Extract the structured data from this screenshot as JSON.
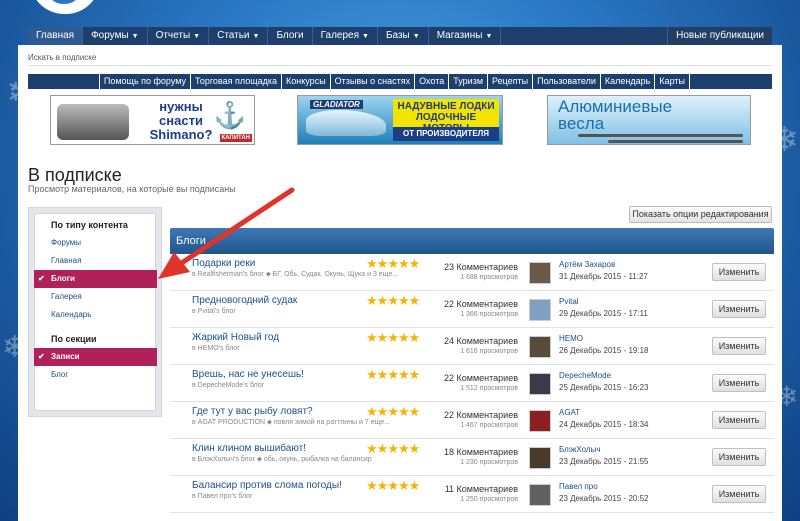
{
  "top_nav": {
    "items": [
      {
        "label": "Главная",
        "caret": ""
      },
      {
        "label": "Форумы",
        "caret": "▼"
      },
      {
        "label": "Отчеты",
        "caret": "▼"
      },
      {
        "label": "Статьи",
        "caret": "▼"
      },
      {
        "label": "Блоги",
        "caret": ""
      },
      {
        "label": "Галерея",
        "caret": "▼"
      },
      {
        "label": "Базы",
        "caret": "▼"
      },
      {
        "label": "Магазины",
        "caret": "▼"
      }
    ],
    "right_label": "Новые публикации"
  },
  "breadcrumb": "Искать в подписке",
  "forum_nav": [
    "Помощь по форуму",
    "Торговая площадка",
    "Конкурсы",
    "Отзывы о снастях",
    "Охота",
    "Туризм",
    "Рецепты",
    "Пользователи",
    "Календарь",
    "Карты"
  ],
  "banners": {
    "shimano": {
      "text": "нужны снасти Shimano?",
      "badge": "КАПИТАН"
    },
    "gladiator": {
      "brand": "GLADIATOR",
      "text": "НАДУВНЫЕ ЛОДКИ ЛОДОЧНЫЕ МОТОРЫ",
      "sub": "ОТ ПРОИЗВОДИТЕЛЯ"
    },
    "oars": {
      "text": "Алюминиевые весла"
    }
  },
  "page_title": "В подписке",
  "page_subtitle": "Просмотр материалов, на которые вы подписаны",
  "edit_options_label": "Показать опции редактирования",
  "sidebar": {
    "content_heading": "По типу контента",
    "content_items": [
      {
        "label": "Форумы",
        "selected": false
      },
      {
        "label": "Главная",
        "selected": false
      },
      {
        "label": "Блоги",
        "selected": true
      },
      {
        "label": "Галерея",
        "selected": false
      },
      {
        "label": "Календарь",
        "selected": false
      }
    ],
    "section_heading": "По секции",
    "section_items": [
      {
        "label": "Записи",
        "selected": true
      },
      {
        "label": "Блог",
        "selected": false
      }
    ]
  },
  "list": {
    "header": "Блоги",
    "rows": [
      {
        "title": "Подарки реки",
        "meta": "в Realfisherman's блог ⬥ БГ, Обь, Судак, Окунь, Щука и 3 еще...",
        "rating": 5,
        "comments": "23 Комментариев",
        "views": "1 688 просмотров",
        "user": "Артём Захаров",
        "date": "31 Декабрь 2015 - 11:27",
        "button": "Изменить"
      },
      {
        "title": "Предновогодний судак",
        "meta": "в Pvital's блог",
        "rating": 5,
        "comments": "22 Комментариев",
        "views": "1 366 просмотров",
        "user": "Pvital",
        "date": "29 Декабрь 2015 - 17:11",
        "button": "Изменить"
      },
      {
        "title": "Жаркий Новый год",
        "meta": "в HEMO's блог",
        "rating": 5,
        "comments": "24 Комментариев",
        "views": "1 616 просмотров",
        "user": "HEMO",
        "date": "26 Декабрь 2015 - 19:18",
        "button": "Изменить"
      },
      {
        "title": "Врешь, нас не унесешь!",
        "meta": "в DepecheMode's блог",
        "rating": 5,
        "comments": "22 Комментариев",
        "views": "1 512 просмотров",
        "user": "DepecheMode",
        "date": "25 Декабрь 2015 - 16:23",
        "button": "Изменить"
      },
      {
        "title": "Где тут у вас рыбу ловят?",
        "meta": "в AGAT PRODUCTION ⬥ повля зимой на раттлины и 7 еще...",
        "rating": 5,
        "comments": "22 Комментариев",
        "views": "1 467 просмотров",
        "user": "AGAT",
        "date": "24 Декабрь 2015 - 18:34",
        "button": "Изменить"
      },
      {
        "title": "Клин клином вышибают!",
        "meta": "в БлэкХолыч's блог ⬥ обь, окунь, рыбалка на балансир",
        "rating": 5,
        "comments": "18 Комментариев",
        "views": "1 230 просмотров",
        "user": "БлэкХолыч",
        "date": "23 Декабрь 2015 - 21:55",
        "button": "Изменить"
      },
      {
        "title": "Балансир против слома погоды!",
        "meta": "в Павел про's блог",
        "rating": 5,
        "comments": "11 Комментариев",
        "views": "1 250 просмотров",
        "user": "Павел про",
        "date": "23 Декабрь 2015 - 20:52",
        "button": "Изменить"
      }
    ]
  },
  "colors": {
    "nav_bg": "#1d3f6e",
    "selected_bg": "#b0215c",
    "list_header": "#2d64a0",
    "link": "#1e4f8a",
    "star": "#f6b400",
    "arrow": "#e0332a"
  }
}
